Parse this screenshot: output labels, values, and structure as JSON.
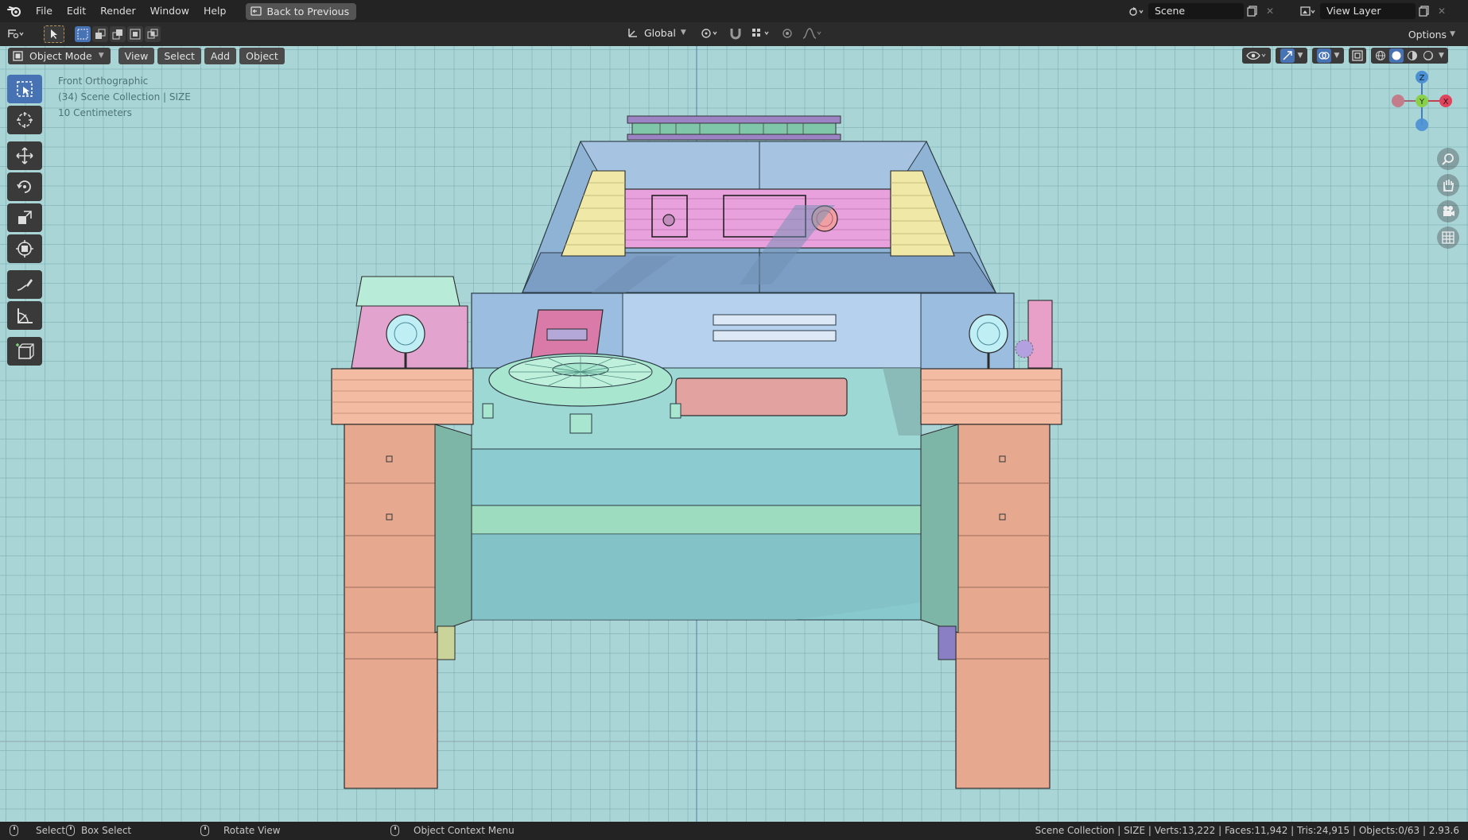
{
  "topbar": {
    "menus": [
      "File",
      "Edit",
      "Render",
      "Window",
      "Help"
    ],
    "back_button": "Back to Previous",
    "scene_label": "Scene",
    "view_layer_label": "View Layer"
  },
  "toolheader": {
    "transform_orientation": "Global",
    "options_label": "Options"
  },
  "viewport_header": {
    "mode": "Object Mode",
    "menus": [
      "View",
      "Select",
      "Add",
      "Object"
    ]
  },
  "overlay": {
    "view_name": "Front Orthographic",
    "collection": "(34) Scene Collection | SIZE",
    "scale": "10 Centimeters"
  },
  "gizmo": {
    "z": "Z",
    "y": "Y",
    "x": "X"
  },
  "statusbar": {
    "select": "Select",
    "box_select": "Box Select",
    "rotate_view": "Rotate View",
    "context_menu": "Object Context Menu",
    "stats": "Scene Collection | SIZE | Verts:13,222 | Faces:11,942 | Tris:24,915 | Objects:0/63 | 2.93.6"
  },
  "colors": {
    "viewport_bg": "#a9d5d7",
    "accent": "#4772b3",
    "header_bg": "#2b2b2b",
    "topbar_bg": "#232323"
  },
  "icons": [
    "blender-logo-icon",
    "select-box-icon",
    "cursor-icon",
    "move-icon",
    "rotate-icon",
    "scale-icon",
    "transform-icon",
    "annotate-icon",
    "measure-icon",
    "add-cube-icon",
    "zoom-icon",
    "hand-icon",
    "camera-icon",
    "grid-icon"
  ]
}
